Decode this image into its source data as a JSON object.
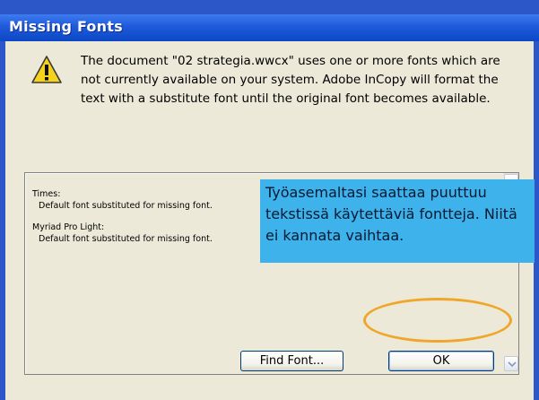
{
  "dialog": {
    "title": "Missing Fonts",
    "message": "The document \"02 strategia.wwcx\" uses one or more fonts which are not currently available on your system. Adobe InCopy will format the text with a substitute font until the original font becomes available."
  },
  "missing_fonts": [
    {
      "name": "Times:",
      "description": "Default font substituted for missing font."
    },
    {
      "name": "Myriad Pro Light:",
      "description": "Default font substituted for missing font."
    }
  ],
  "annotation": {
    "text": "Työasemaltasi saattaa puuttuu tekstissä käytettäviä fontteja. Niitä ei kannata vaihtaa."
  },
  "buttons": {
    "find_font": "Find Font...",
    "ok": "OK"
  },
  "colors": {
    "title_bar": "#0c47c6",
    "dialog_background": "#ece9d8",
    "callout_background": "#3eb2ea",
    "highlight_ring": "#f0a62b"
  },
  "icons": {
    "message_icon": "warning-icon"
  }
}
